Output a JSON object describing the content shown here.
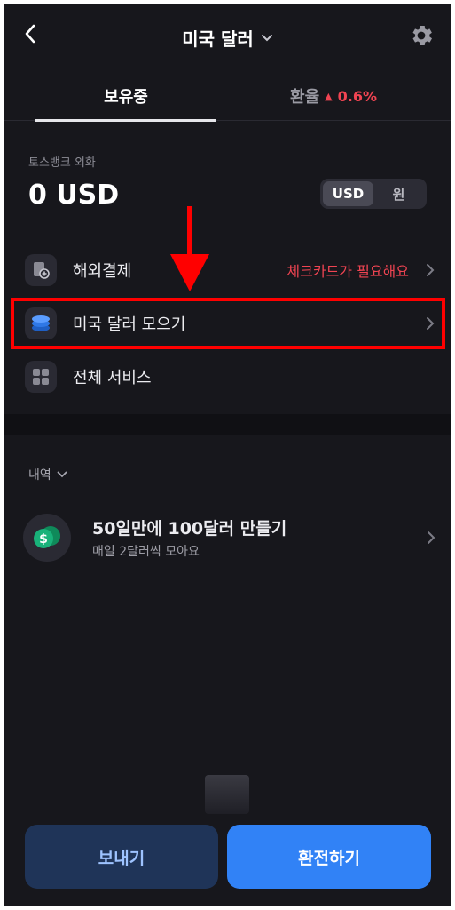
{
  "header": {
    "title": "미국 달러",
    "back_icon": "chevron-left-icon",
    "title_dropdown_icon": "chevron-down-icon",
    "settings_icon": "gear-icon"
  },
  "tabs": [
    {
      "label": "보유중",
      "active": true
    },
    {
      "label": "환율",
      "change": "0.6%",
      "change_direction": "up",
      "change_color": "#f04452"
    }
  ],
  "account": {
    "label": "토스뱅크 외화",
    "balance": "0 USD",
    "currency_toggle": {
      "options": [
        "USD",
        "원"
      ],
      "selected": "USD"
    }
  },
  "menu": [
    {
      "label": "해외결제",
      "icon": "card-add-icon",
      "right_text": "체크카드가 필요해요"
    },
    {
      "label": "미국 달러 모으기",
      "icon": "coin-stack-icon",
      "highlighted": true
    },
    {
      "label": "전체 서비스",
      "icon": "grid-icon"
    }
  ],
  "history": {
    "toggle_label": "내역",
    "items": [
      {
        "title": "50일만에 100달러 만들기",
        "subtitle": "매일 2달러씩 모아요",
        "icon": "dollar-coin-icon"
      }
    ]
  },
  "bottom": {
    "send_label": "보내기",
    "exchange_label": "환전하기"
  },
  "colors": {
    "background": "#17171c",
    "accent_blue": "#3182f6",
    "rise_red": "#f04452",
    "annotation_red": "#ff0000"
  }
}
